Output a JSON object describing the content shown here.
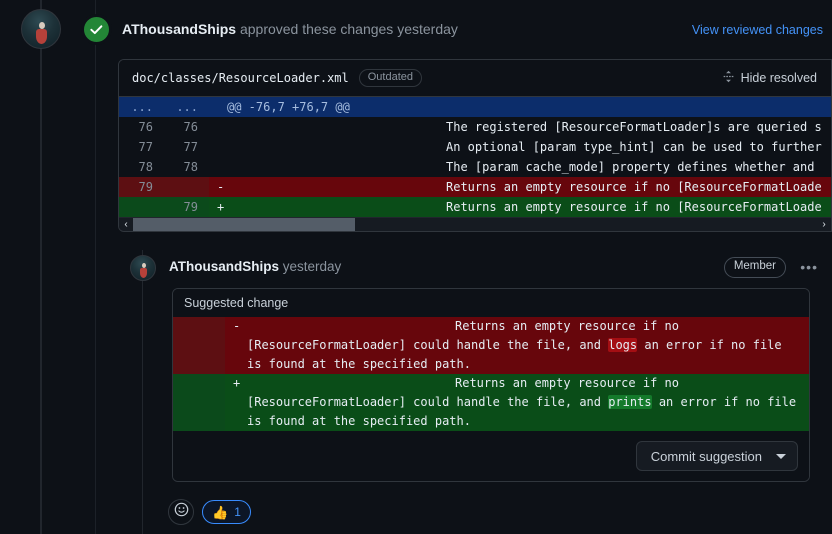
{
  "review": {
    "username": "AThousandShips",
    "action_text": " approved these changes yesterday",
    "status_icon": "check-circle-icon",
    "view_link": "View reviewed changes",
    "accent_green": "#238636",
    "link_blue": "#4493f8"
  },
  "file_diff": {
    "path": "doc/classes/ResourceLoader.xml",
    "badge": "Outdated",
    "hide_resolved": "Hide resolved",
    "fold_icon": "fold-unfold-icon",
    "hunk": {
      "old_ln": "...",
      "new_ln": "...",
      "marker": "",
      "text": "@@ -76,7 +76,7 @@"
    },
    "rows": [
      {
        "type": "ctx",
        "old_ln": "76",
        "new_ln": "76",
        "marker": "",
        "code": "The registered [ResourceFormatLoader]s are queried s"
      },
      {
        "type": "ctx",
        "old_ln": "77",
        "new_ln": "77",
        "marker": "",
        "code": "An optional [param type_hint] can be used to further"
      },
      {
        "type": "ctx",
        "old_ln": "78",
        "new_ln": "78",
        "marker": "",
        "code": "The [param cache_mode] property defines whether and"
      },
      {
        "type": "del",
        "old_ln": "79",
        "new_ln": "",
        "marker": "-",
        "code": "Returns an empty resource if no [ResourceFormatLoade"
      },
      {
        "type": "add",
        "old_ln": "",
        "new_ln": "79",
        "marker": "+",
        "code": "Returns an empty resource if no [ResourceFormatLoade"
      }
    ],
    "scrollbar": {
      "left_arrow": "‹",
      "right_arrow": "›"
    }
  },
  "comment": {
    "username": "AThousandShips",
    "timestamp": " yesterday",
    "member_badge": "Member",
    "kebab": "•••",
    "suggested_label": "Suggested change",
    "deleted": {
      "marker": "-",
      "part1": "Returns an empty resource if no [ResourceFormatLoader] could handle the file, and ",
      "highlight": "logs",
      "part2": " an error if no file is found at the specified path."
    },
    "added": {
      "marker": "+",
      "part1": "Returns an empty resource if no [ResourceFormatLoader] could handle the file, and ",
      "highlight": "prints",
      "part2": " an error if no file is found at the specified path."
    },
    "commit_button": "Commit suggestion"
  },
  "reactions": {
    "add_icon": "smiley-add-reaction-icon",
    "thumbs_up_emoji": "👍",
    "thumbs_up_count": "1"
  }
}
